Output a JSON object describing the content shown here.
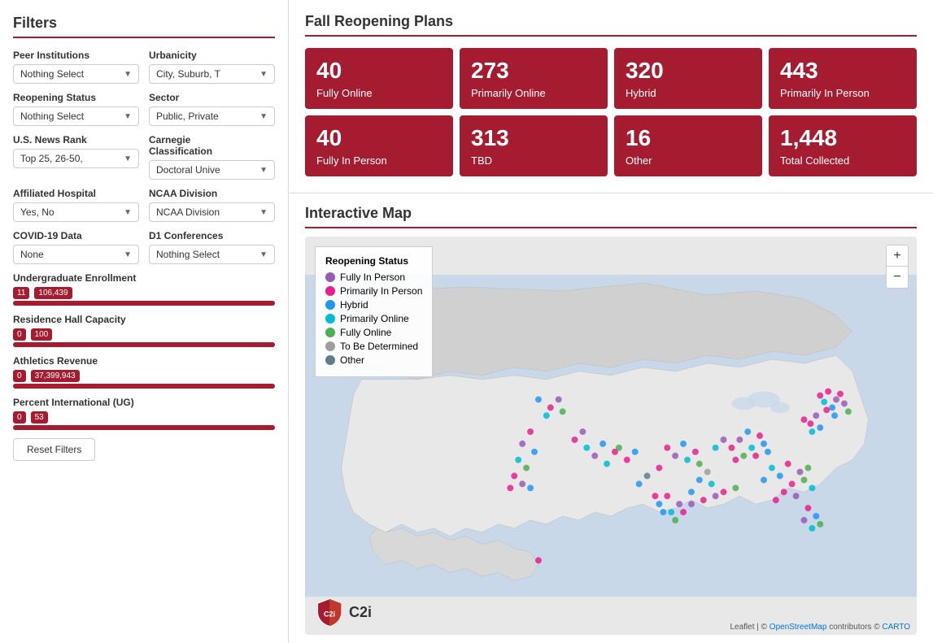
{
  "sidebar": {
    "title": "Filters",
    "filters": [
      {
        "id": "peer-institutions",
        "label": "Peer Institutions",
        "value": "Nothing Select",
        "col": "left"
      },
      {
        "id": "urbanicity",
        "label": "Urbanicity",
        "value": "City, Suburb, T",
        "col": "right"
      },
      {
        "id": "reopening-status",
        "label": "Reopening Status",
        "value": "Nothing Select",
        "col": "left"
      },
      {
        "id": "sector",
        "label": "Sector",
        "value": "Public, Private",
        "col": "right"
      },
      {
        "id": "us-news-rank",
        "label": "U.S. News Rank",
        "value": "Top 25, 26-50,",
        "col": "left"
      },
      {
        "id": "carnegie",
        "label": "Carnegie Classification",
        "value": "Doctoral Unive",
        "col": "right"
      },
      {
        "id": "affiliated-hospital",
        "label": "Affiliated Hospital",
        "value": "Yes, No",
        "col": "left"
      },
      {
        "id": "ncaa-division",
        "label": "NCAA Division",
        "value": "NCAA Division",
        "col": "right"
      },
      {
        "id": "covid19-data",
        "label": "COVID-19 Data",
        "value": "None",
        "col": "left"
      },
      {
        "id": "d1-conferences",
        "label": "D1 Conferences",
        "value": "Nothing Select",
        "col": "right"
      }
    ],
    "sliders": [
      {
        "id": "undergrad-enrollment",
        "label": "Undergraduate Enrollment",
        "min": "11",
        "max": "106,439",
        "fill_pct": 100
      },
      {
        "id": "residence-hall",
        "label": "Residence Hall Capacity",
        "min": "0",
        "max": "100",
        "fill_pct": 100
      },
      {
        "id": "athletics-revenue",
        "label": "Athletics Revenue",
        "min": "0",
        "max": "37,399,943",
        "fill_pct": 100
      },
      {
        "id": "percent-international",
        "label": "Percent International (UG)",
        "min": "0",
        "max": "53",
        "fill_pct": 100
      }
    ],
    "reset_label": "Reset Filters"
  },
  "reopening_plans": {
    "title": "Fall Reopening Plans",
    "stats": [
      {
        "id": "fully-online",
        "number": "40",
        "label": "Fully Online"
      },
      {
        "id": "primarily-online",
        "number": "273",
        "label": "Primarily Online"
      },
      {
        "id": "hybrid",
        "number": "320",
        "label": "Hybrid"
      },
      {
        "id": "primarily-in-person",
        "number": "443",
        "label": "Primarily In Person"
      },
      {
        "id": "fully-in-person",
        "number": "40",
        "label": "Fully In Person"
      },
      {
        "id": "tbd",
        "number": "313",
        "label": "TBD"
      },
      {
        "id": "other",
        "number": "16",
        "label": "Other"
      },
      {
        "id": "total",
        "number": "1,448",
        "label": "Total Collected"
      }
    ]
  },
  "map": {
    "title": "Interactive Map",
    "legend_title": "Reopening Status",
    "legend_items": [
      {
        "label": "Fully In Person",
        "color": "#9b59b6"
      },
      {
        "label": "Primarily In Person",
        "color": "#e91e8c"
      },
      {
        "label": "Hybrid",
        "color": "#2196f3"
      },
      {
        "label": "Primarily Online",
        "color": "#00bcd4"
      },
      {
        "label": "Fully Online",
        "color": "#4caf50"
      },
      {
        "label": "To Be Determined",
        "color": "#9e9e9e"
      },
      {
        "label": "Other",
        "color": "#607d8b"
      }
    ],
    "zoom_in": "+",
    "zoom_out": "−",
    "attribution": "Leaflet | © OpenStreetMap contributors © CARTO"
  },
  "colors": {
    "accent": "#a51c30",
    "brand": "#a51c30"
  }
}
